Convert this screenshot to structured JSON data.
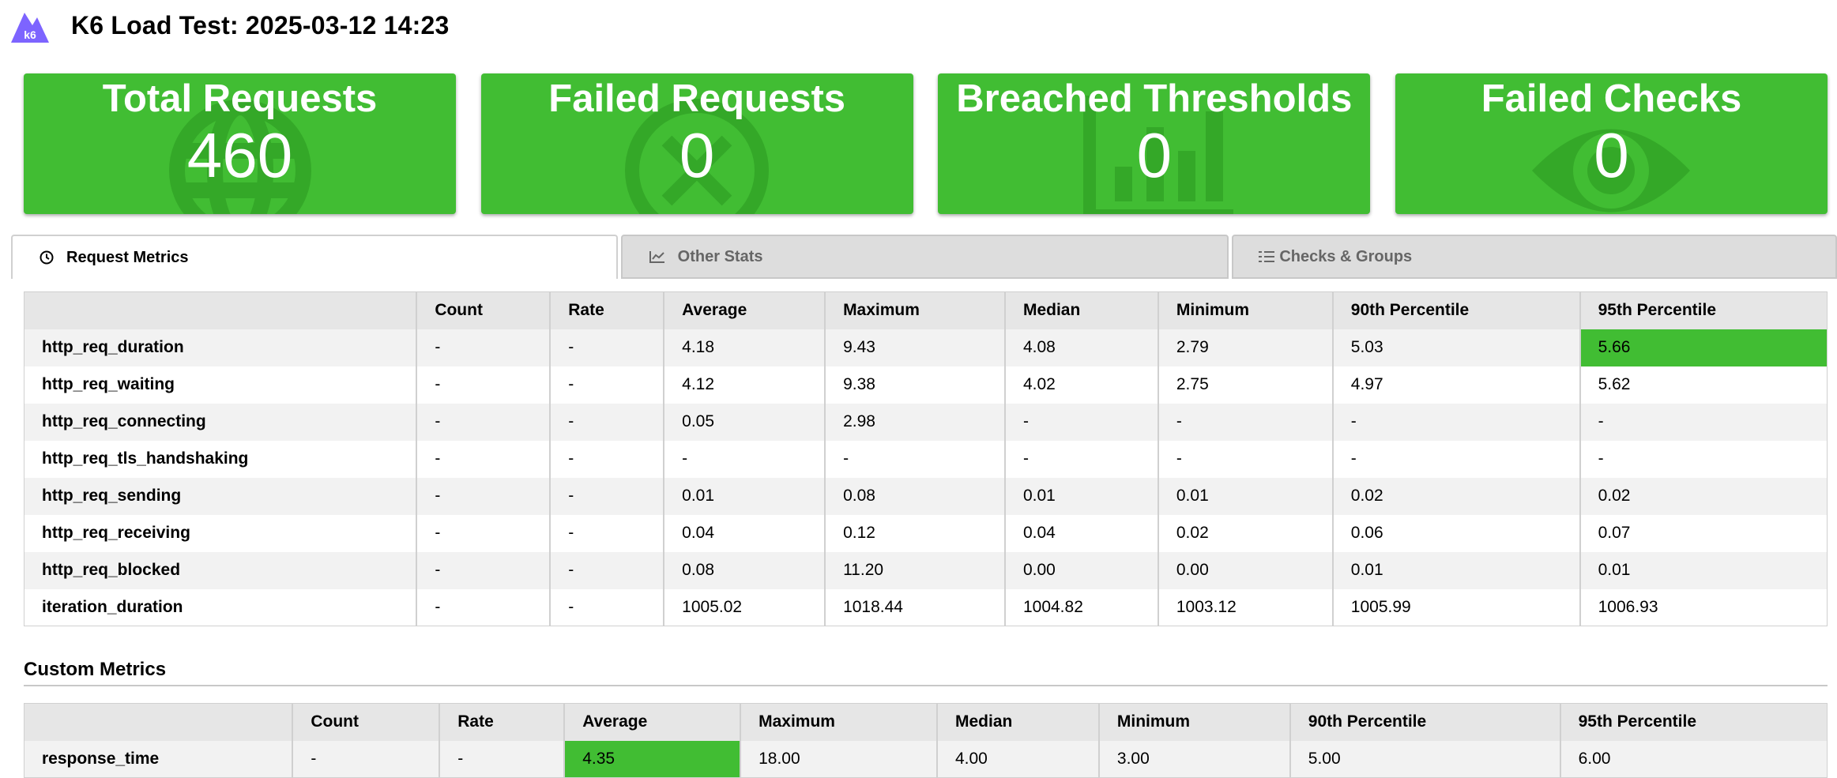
{
  "header": {
    "logo": "k6-logo-icon",
    "title": "K6 Load Test: 2025-03-12 14:23"
  },
  "colors": {
    "accent": "#41bd33",
    "tab_inactive": "#dddddd",
    "header_row": "#e6e6e6"
  },
  "cards": [
    {
      "title": "Total Requests",
      "value": "460",
      "icon": "globe-icon"
    },
    {
      "title": "Failed Requests",
      "value": "0",
      "icon": "x-circle-icon"
    },
    {
      "title": "Breached Thresholds",
      "value": "0",
      "icon": "bar-chart-icon"
    },
    {
      "title": "Failed Checks",
      "value": "0",
      "icon": "eye-icon"
    }
  ],
  "tabs": [
    {
      "label": "Request Metrics",
      "icon": "clock-icon",
      "active": true
    },
    {
      "label": "Other Stats",
      "icon": "line-chart-icon",
      "active": false
    },
    {
      "label": "Checks & Groups",
      "icon": "checklist-icon",
      "active": false
    }
  ],
  "request_metrics": {
    "columns": [
      "",
      "Count",
      "Rate",
      "Average",
      "Maximum",
      "Median",
      "Minimum",
      "90th Percentile",
      "95th Percentile"
    ],
    "rows": [
      [
        "http_req_duration",
        "-",
        "-",
        "4.18",
        "9.43",
        "4.08",
        "2.79",
        "5.03",
        "5.66"
      ],
      [
        "http_req_waiting",
        "-",
        "-",
        "4.12",
        "9.38",
        "4.02",
        "2.75",
        "4.97",
        "5.62"
      ],
      [
        "http_req_connecting",
        "-",
        "-",
        "0.05",
        "2.98",
        "-",
        "-",
        "-",
        "-"
      ],
      [
        "http_req_tls_handshaking",
        "-",
        "-",
        "-",
        "-",
        "-",
        "-",
        "-",
        "-"
      ],
      [
        "http_req_sending",
        "-",
        "-",
        "0.01",
        "0.08",
        "0.01",
        "0.01",
        "0.02",
        "0.02"
      ],
      [
        "http_req_receiving",
        "-",
        "-",
        "0.04",
        "0.12",
        "0.04",
        "0.02",
        "0.06",
        "0.07"
      ],
      [
        "http_req_blocked",
        "-",
        "-",
        "0.08",
        "11.20",
        "0.00",
        "0.00",
        "0.01",
        "0.01"
      ],
      [
        "iteration_duration",
        "-",
        "-",
        "1005.02",
        "1018.44",
        "1004.82",
        "1003.12",
        "1005.99",
        "1006.93"
      ]
    ],
    "highlighted_cells": [
      {
        "row": 0,
        "col": 8
      }
    ]
  },
  "custom_metrics": {
    "title": "Custom Metrics",
    "columns": [
      "",
      "Count",
      "Rate",
      "Average",
      "Maximum",
      "Median",
      "Minimum",
      "90th Percentile",
      "95th Percentile"
    ],
    "rows": [
      [
        "response_time",
        "-",
        "-",
        "4.35",
        "18.00",
        "4.00",
        "3.00",
        "5.00",
        "6.00"
      ]
    ],
    "highlighted_cells": [
      {
        "row": 0,
        "col": 3
      }
    ]
  }
}
